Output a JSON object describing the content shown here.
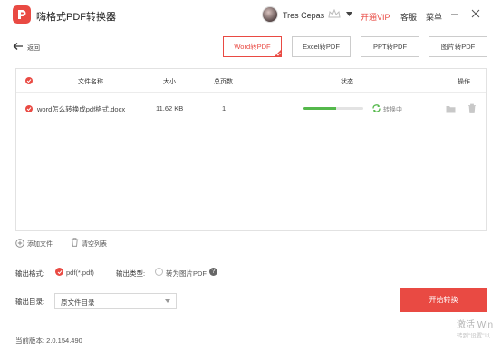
{
  "app": {
    "title": "嗨格式PDF转换器"
  },
  "header": {
    "user_name": "Tres Cepas",
    "vip_label": "开通VIP",
    "service_label": "客服",
    "menu_label": "菜单"
  },
  "nav": {
    "back_label": "返回"
  },
  "mode_tabs": [
    {
      "label": "Word转PDF",
      "active": true
    },
    {
      "label": "Excel转PDF",
      "active": false
    },
    {
      "label": "PPT转PDF",
      "active": false
    },
    {
      "label": "图片转PDF",
      "active": false
    }
  ],
  "table": {
    "columns": [
      "文件名称",
      "大小",
      "总页数",
      "状态",
      "操作"
    ],
    "rows": [
      {
        "name": "word怎么转换成pdf格式.docx",
        "size": "11.62 KB",
        "pages": "1",
        "status": "转换中",
        "progress": 0.55
      }
    ]
  },
  "actions": {
    "add_file": "添加文件",
    "clear_list": "清空列表"
  },
  "output": {
    "format_label": "输出格式:",
    "format_value": "pdf(*.pdf)",
    "type_label": "输出类型:",
    "type_value": "转为图片PDF",
    "dir_label": "输出目录:",
    "dir_value": "原文件目录"
  },
  "start_button": "开始转换",
  "footer": {
    "version": "当前版本: 2.0.154.490"
  },
  "watermark": {
    "line1": "激活 Win",
    "line2": "转到\"设置\"以"
  },
  "colors": {
    "accent": "#e94a43",
    "progress": "#54b84b"
  }
}
